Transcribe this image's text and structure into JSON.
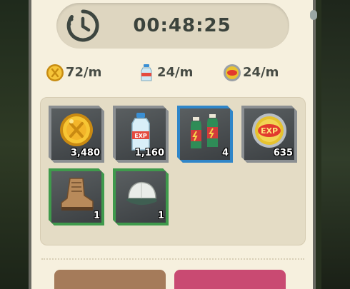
{
  "timer": {
    "value": "00:48:25",
    "icon": "stopwatch-icon"
  },
  "rates": [
    {
      "icon": "gold-coin-icon",
      "label": "72/m"
    },
    {
      "icon": "exp-bottle-icon",
      "label": "24/m"
    },
    {
      "icon": "exp-chip-icon",
      "label": "24/m"
    }
  ],
  "rewards": [
    {
      "icon": "gold-coin-icon",
      "count": "3,480",
      "rarity": "gray"
    },
    {
      "icon": "exp-bottle-icon",
      "count": "1,160",
      "rarity": "gray"
    },
    {
      "icon": "energy-drinks-icon",
      "count": "4",
      "rarity": "blue"
    },
    {
      "icon": "exp-chip-icon",
      "count": "635",
      "rarity": "gray"
    },
    {
      "icon": "boots-icon",
      "count": "1",
      "rarity": "green"
    },
    {
      "icon": "cap-icon",
      "count": "1",
      "rarity": "green"
    }
  ],
  "buttons": {
    "left_label": "",
    "right_label": ""
  },
  "colors": {
    "panel": "#f6f0de",
    "rarity_gray": "#8b8f92",
    "rarity_blue": "#2f86c9",
    "rarity_green": "#3f9a4c",
    "button_left": "#a57b5a",
    "button_right": "#c94a72"
  }
}
